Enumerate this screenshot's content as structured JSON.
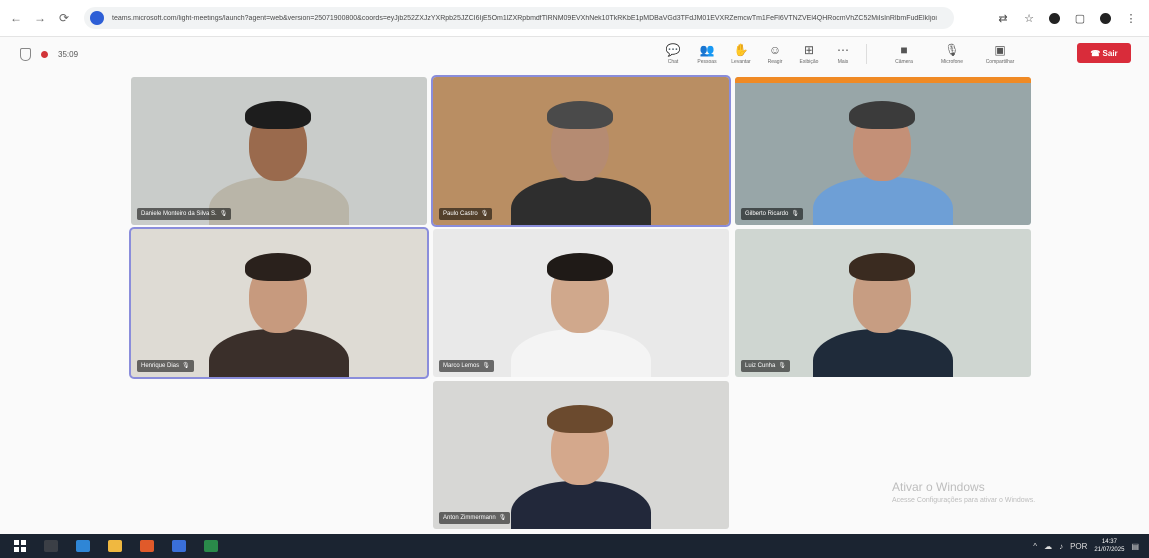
{
  "browser": {
    "url": "teams.microsoft.com/light-meetings/launch?agent=web&version=25071900800&coords=eyJjb252ZXJzYXRpb25JZCI6IjE5Om1lZXRpbmdfTlRNM09EVXhNek10TkRKbE1pMDBaVGd3TFdJM01EVXRZemcwTm1FeFl6VTNZVEl4QHRocmVhZC52MiIsInRlbmFudElkIjoi",
    "back_icon": "←",
    "forward_icon": "→",
    "reload_icon": "⟳"
  },
  "meeting": {
    "timer": "35:09",
    "tools": [
      {
        "icon": "💬",
        "label": "Chat"
      },
      {
        "icon": "👥",
        "label": "Pessoas"
      },
      {
        "icon": "✋",
        "label": "Levantar"
      },
      {
        "icon": "☺",
        "label": "Reagir"
      },
      {
        "icon": "⊞",
        "label": "Exibição"
      },
      {
        "icon": "⋯",
        "label": "Mais"
      }
    ],
    "media": [
      {
        "icon": "■",
        "label": "Câmera"
      },
      {
        "icon": "🎙",
        "label": "Microfone"
      },
      {
        "icon": "▣",
        "label": "Compartilhar"
      }
    ],
    "leave_label": "Sair",
    "leave_icon": "☎"
  },
  "participants": [
    {
      "name": "Daniele Monteiro da Silva S.",
      "bg": "#c9ccca",
      "skin": "#9a6a4d",
      "shirt": "#b9b5a8",
      "hair": "#1d1d1d"
    },
    {
      "name": "Paulo Castro",
      "bg": "#b98e63",
      "skin": "#b58b72",
      "shirt": "#2e2e2e",
      "hair": "#4a4a4a"
    },
    {
      "name": "Gilberto Ricardo",
      "bg": "#98a6a8",
      "skin": "#c49077",
      "shirt": "#6e9fd6",
      "hair": "#3b3b3b"
    },
    {
      "name": "Henrique Dias",
      "bg": "#dedbd4",
      "skin": "#c79a7e",
      "shirt": "#3a2f2a",
      "hair": "#2a211c"
    },
    {
      "name": "Marco Lemos",
      "bg": "#e9e9e9",
      "skin": "#d0a88c",
      "shirt": "#f4f4f4",
      "hair": "#1f1a17"
    },
    {
      "name": "Luiz Cunha",
      "bg": "#cfd6d1",
      "skin": "#c79d82",
      "shirt": "#1f2b3a",
      "hair": "#3a2b20"
    },
    {
      "name": "Anton Zimmermann",
      "bg": "#d7d7d5",
      "skin": "#d4a88c",
      "shirt": "#22283a",
      "hair": "#6b4a2e"
    }
  ],
  "watermark": {
    "title": "Ativar o Windows",
    "subtitle": "Acesse Configurações para ativar o Windows."
  },
  "taskbar": {
    "apps": [
      "#3b3f46",
      "#2f86d6",
      "#f0b840",
      "#e05a2a",
      "#3a6fd8",
      "#2a8a4a"
    ],
    "tray": {
      "language": "POR",
      "time": "14:37",
      "date": "21/07/2025"
    }
  }
}
